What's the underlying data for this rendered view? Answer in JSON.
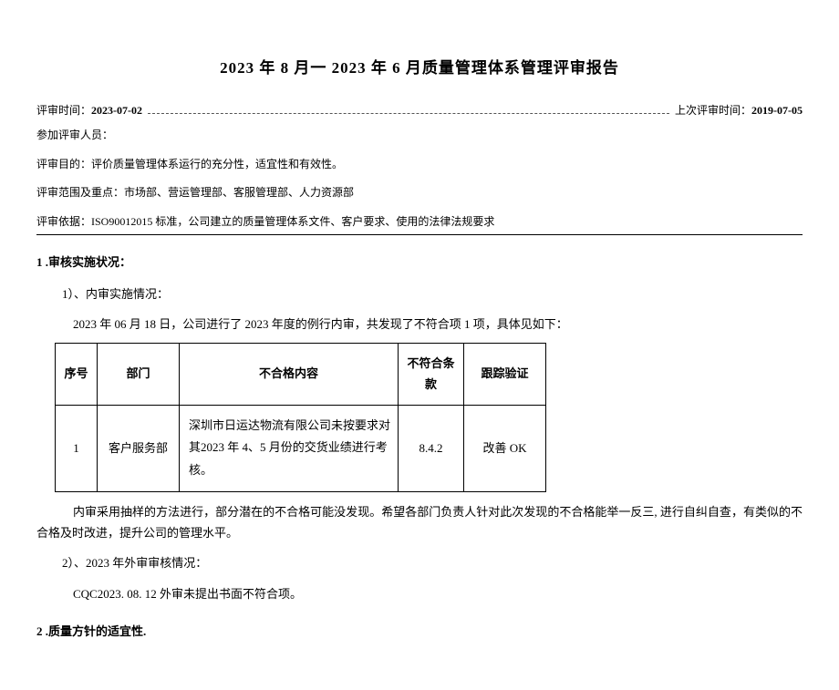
{
  "title": "2023 年 8 月一 2023 年 6 月质量管理体系管理评审报告",
  "meta": {
    "review_time_label": "评审时间：",
    "review_time_value": "2023-07-02",
    "last_review_label": "上次评审时间：",
    "last_review_value": "2019-07-05",
    "participants_label": "参加评审人员：",
    "purpose_label": "评审目的：",
    "purpose_value": "评价质量管理体系运行的充分性，适宜性和有效性。",
    "scope_label": "评审范围及重点：",
    "scope_value": "市场部、营运管理部、客服管理部、人力资源部",
    "basis_label": "评审依据：",
    "basis_value": "ISO90012015 标准，公司建立的质量管理体系文件、客户要求、使用的法律法规要求"
  },
  "sections": {
    "s1_heading": "1 .审核实施状况：",
    "s1_1_heading": "1）、内审实施情况：",
    "s1_1_intro": "2023 年 06 月 18 日，公司进行了 2023 年度的例行内审，共发现了不符合项 1 项，具体见如下：",
    "table": {
      "headers": {
        "seq": "序号",
        "dept": "部门",
        "content": "不合格内容",
        "clause": "不符合条款",
        "track": "跟踪验证"
      },
      "rows": [
        {
          "seq": "1",
          "dept": "客户服务部",
          "content": "深圳市日运达物流有限公司未按要求对其2023 年 4、5 月份的交货业绩进行考核。",
          "clause": "8.4.2",
          "track": "改善 OK"
        }
      ]
    },
    "s1_1_note": "内审采用抽样的方法进行，部分潜在的不合格可能没发现。希望各部门负责人针对此次发现的不合格能举一反三, 进行自纠自查，有类似的不合格及时改进，提升公司的管理水平。",
    "s1_2_heading": "2）、2023 年外审审核情况：",
    "s1_2_body": "CQC2023. 08. 12 外审未提出书面不符合项。",
    "s2_heading": "2 .质量方针的适宜性."
  }
}
